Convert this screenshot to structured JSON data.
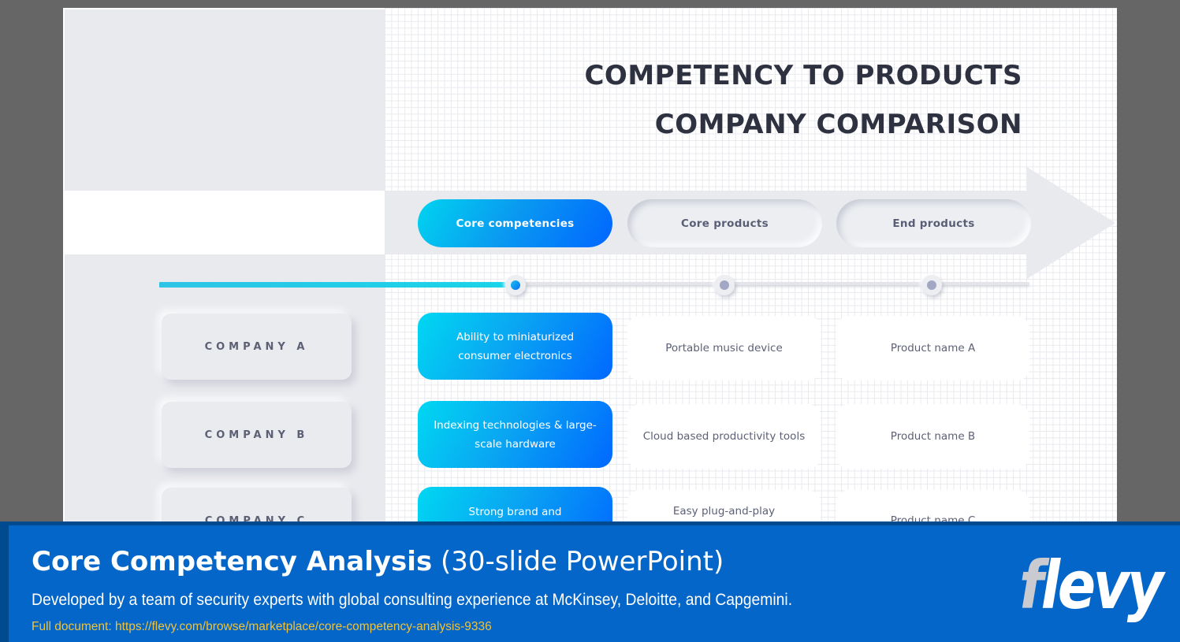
{
  "slide": {
    "title_line1": "COMPETENCY TO PRODUCTS",
    "title_line2": "COMPANY COMPARISON",
    "stages": [
      {
        "label": "Core competencies",
        "active": true
      },
      {
        "label": "Core products",
        "active": false
      },
      {
        "label": "End products",
        "active": false
      }
    ],
    "progress_stage": 1,
    "companies": [
      {
        "name": "COMPANY A",
        "competency": "Ability to miniaturized consumer electronics",
        "core_product": "Portable music device",
        "end_product": "Product name A"
      },
      {
        "name": "COMPANY B",
        "competency": "Indexing technologies & large-scale hardware",
        "core_product": "Cloud based productivity tools",
        "end_product": "Product name B"
      },
      {
        "name": "COMPANY C",
        "competency": "Strong brand and",
        "core_product": "Easy plug-and-play",
        "end_product": "Product name C"
      }
    ],
    "colors": {
      "accent_start": "#00d4f0",
      "accent_end": "#0066ff",
      "title_text": "#2e3140",
      "muted_text": "#5c6075",
      "panel_bg": "#e9eaee"
    }
  },
  "banner": {
    "title_strong": "Core Competency Analysis",
    "title_light": "(30-slide PowerPoint)",
    "subtitle": "Developed by a team of security experts with global consulting experience at McKinsey, Deloitte, and Capgemini.",
    "link": "Full document: https://flevy.com/browse/marketplace/core-competency-analysis-9336",
    "logo_first": "f",
    "logo_rest": "levy",
    "colors": {
      "background": "#0466c8",
      "border": "#004a8f",
      "link": "#f0c23a"
    }
  }
}
